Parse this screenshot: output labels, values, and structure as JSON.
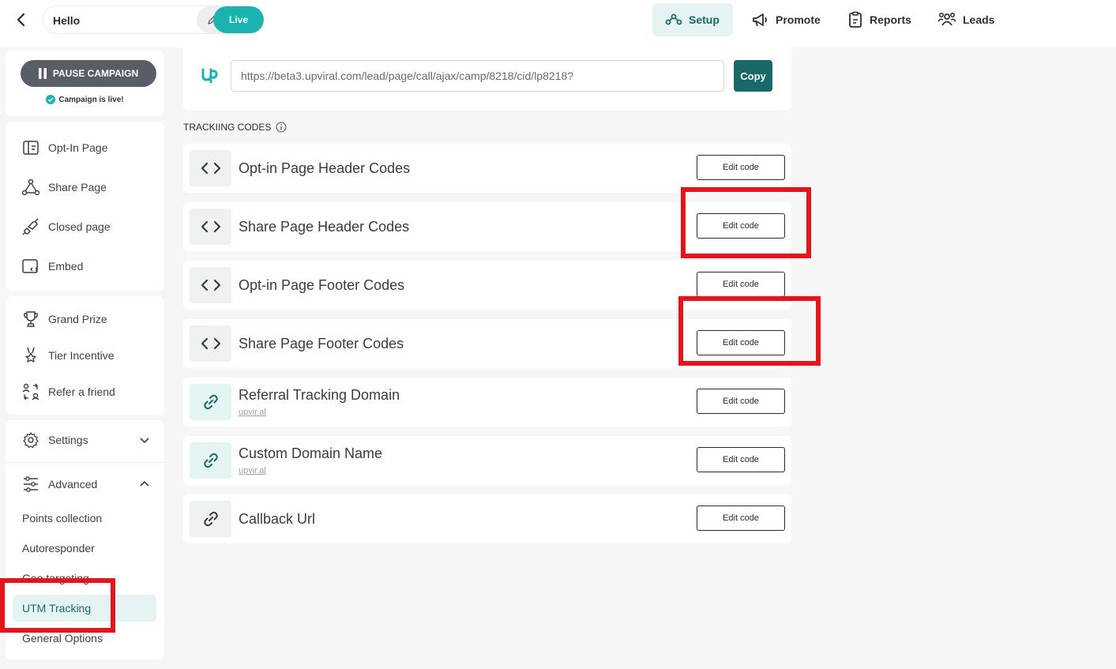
{
  "topbar": {
    "back_icon": "chevron-left-icon",
    "campaign_name": "Hello",
    "live_label": "Live",
    "nav": [
      {
        "label": "Setup",
        "icon": "setup-icon",
        "active": true
      },
      {
        "label": "Promote",
        "icon": "megaphone-icon",
        "active": false
      },
      {
        "label": "Reports",
        "icon": "clipboard-icon",
        "active": false
      },
      {
        "label": "Leads",
        "icon": "users-icon",
        "active": false
      }
    ]
  },
  "sidebar": {
    "pause_label": "PAUSE CAMPAIGN",
    "live_status": "Campaign is live!",
    "pages": [
      {
        "label": "Opt-In Page",
        "icon": "optin-page-icon"
      },
      {
        "label": "Share Page",
        "icon": "share-nodes-icon"
      },
      {
        "label": "Closed page",
        "icon": "unplug-icon"
      },
      {
        "label": "Embed",
        "icon": "embed-icon"
      }
    ],
    "rewards": [
      {
        "label": "Grand Prize",
        "icon": "trophy-icon"
      },
      {
        "label": "Tier Incentive",
        "icon": "medal-icon"
      },
      {
        "label": "Refer a friend",
        "icon": "refer-icon"
      }
    ],
    "settings_label": "Settings",
    "advanced_label": "Advanced",
    "advanced_items": [
      {
        "label": "Points collection",
        "active": false
      },
      {
        "label": "Autoresponder",
        "active": false
      },
      {
        "label": "Geo targeting",
        "active": false
      },
      {
        "label": "UTM Tracking",
        "active": true
      },
      {
        "label": "General Options",
        "active": false
      }
    ]
  },
  "main": {
    "url_value": "https://beta3.upviral.com/lead/page/call/ajax/camp/8218/cid/lp8218?",
    "copy_label": "Copy",
    "section_title": "TRACKIING CODES",
    "rows": [
      {
        "label": "Opt-in Page Header Codes",
        "sub": "",
        "icon": "code-icon",
        "button": "Edit code"
      },
      {
        "label": "Share Page Header Codes",
        "sub": "",
        "icon": "code-icon",
        "button": "Edit code"
      },
      {
        "label": "Opt-in Page Footer Codes",
        "sub": "",
        "icon": "code-icon",
        "button": "Edit code"
      },
      {
        "label": "Share Page Footer Codes",
        "sub": "",
        "icon": "code-icon",
        "button": "Edit code"
      },
      {
        "label": "Referral Tracking Domain",
        "sub": "upvir.al",
        "icon": "link-icon",
        "button": "Edit code"
      },
      {
        "label": "Custom Domain Name",
        "sub": "upvir.al",
        "icon": "link-icon",
        "button": "Edit code"
      },
      {
        "label": "Callback Url",
        "sub": "",
        "icon": "link-icon",
        "button": "Edit code"
      }
    ]
  },
  "colors": {
    "accent": "#176a68",
    "live": "#19b3b0",
    "highlight": "#e3141b"
  }
}
